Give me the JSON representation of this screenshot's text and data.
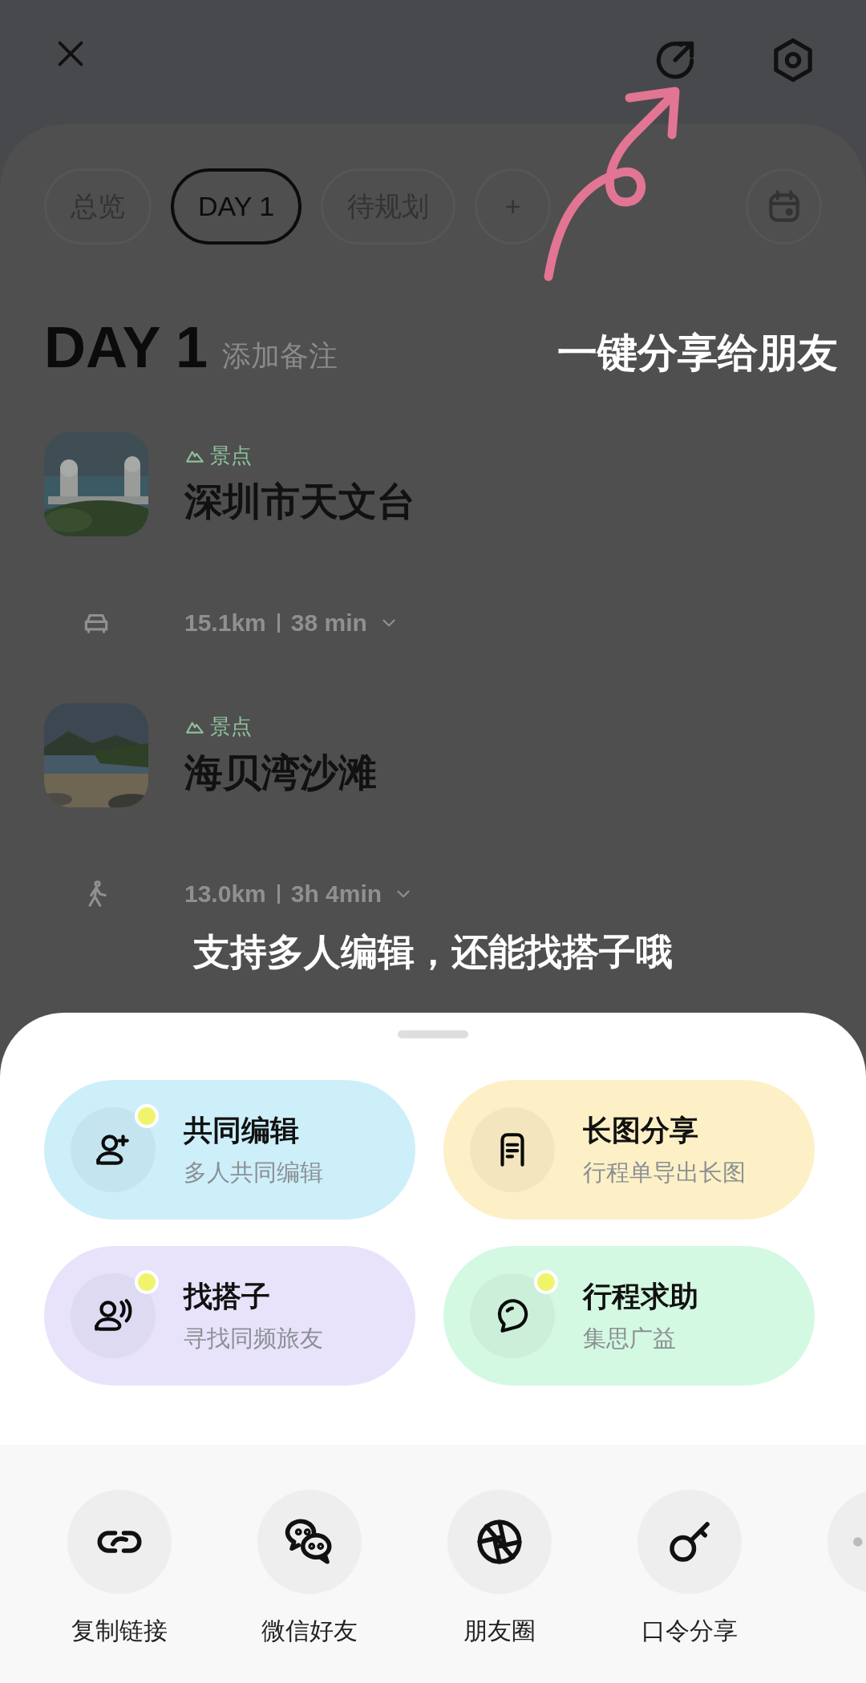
{
  "tabs": [
    {
      "label": "总览",
      "selected": false
    },
    {
      "label": "DAY 1",
      "selected": true
    },
    {
      "label": "待规划",
      "selected": false
    },
    {
      "label": "+",
      "selected": false
    }
  ],
  "day": {
    "title": "DAY 1",
    "note": "添加备注"
  },
  "share_hint": "一键分享给朋友",
  "itinerary": [
    {
      "kind": "place",
      "tag": "景点",
      "title": "深圳市天文台"
    },
    {
      "kind": "drive",
      "distance": "15.1km",
      "duration": "38 min"
    },
    {
      "kind": "place",
      "tag": "景点",
      "title": "海贝湾沙滩"
    },
    {
      "kind": "walk",
      "distance": "13.0km",
      "duration": "3h 4min"
    }
  ],
  "caption": "支持多人编辑，还能找搭子哦",
  "actions": [
    {
      "kind": "coedit",
      "title": "共同编辑",
      "subtitle": "多人共同编辑",
      "color": "#cdeffa",
      "badge": true
    },
    {
      "kind": "longimage",
      "title": "长图分享",
      "subtitle": "行程单导出长图",
      "color": "#fdf0c6",
      "badge": false
    },
    {
      "kind": "buddy",
      "title": "找搭子",
      "subtitle": "寻找同频旅友",
      "color": "#e8e3fb",
      "badge": true
    },
    {
      "kind": "help",
      "title": "行程求助",
      "subtitle": "集思广益",
      "color": "#d4f9e2",
      "badge": true
    }
  ],
  "share_options": [
    {
      "kind": "link",
      "label": "复制链接"
    },
    {
      "kind": "wechat",
      "label": "微信好友"
    },
    {
      "kind": "moments",
      "label": "朋友圈"
    },
    {
      "kind": "key",
      "label": "口令分享"
    },
    {
      "kind": "more"
    }
  ]
}
